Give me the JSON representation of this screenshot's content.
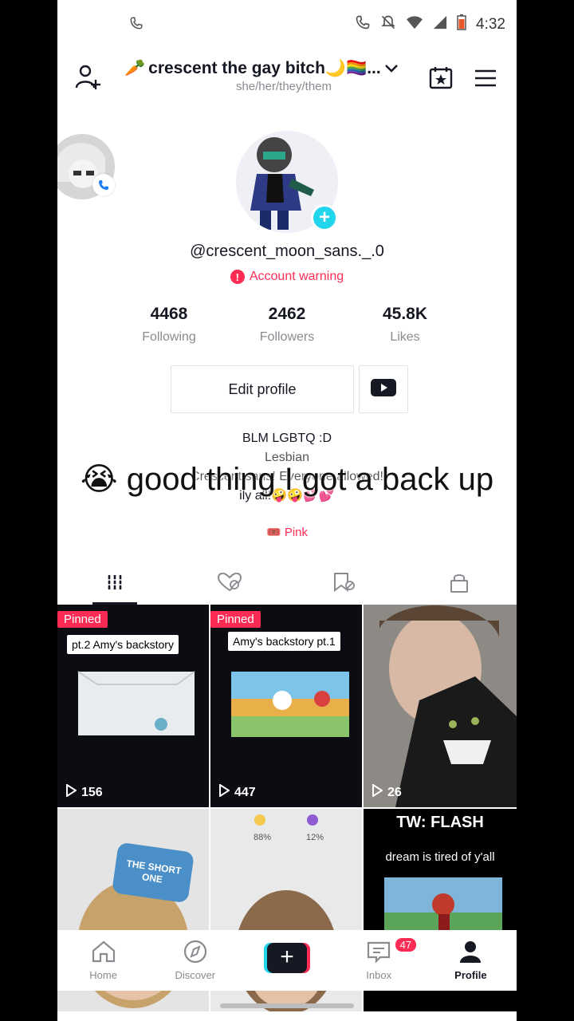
{
  "status_bar": {
    "time": "4:32"
  },
  "header": {
    "title": "crescent the gay bitch🌙🏳️‍🌈...",
    "subtitle": "she/her/they/them",
    "title_emoji": "🥕"
  },
  "profile": {
    "username": "@crescent_moon_sans._.0",
    "warning": "Account warning",
    "stats": [
      {
        "value": "4468",
        "label": "Following"
      },
      {
        "value": "2462",
        "label": "Followers"
      },
      {
        "value": "45.8K",
        "label": "Likes"
      }
    ],
    "edit_button": "Edit profile",
    "bio_lines": [
      "BLM LGBTQ :D",
      "Lesbian",
      "Crescent sans! Everyone allowed!",
      "ily all!🤪🤪💕💕"
    ],
    "link": "🎟️ Pink"
  },
  "overlay_caption": "😭 good thing I got a back up",
  "grid": {
    "pinned_label": "Pinned",
    "videos": [
      {
        "pinned": true,
        "title": "pt.2 Amy's backstory",
        "views": "156"
      },
      {
        "pinned": true,
        "title": "Amy's  backstory pt.1",
        "views": "447"
      },
      {
        "pinned": false,
        "title": "",
        "views": "26"
      },
      {
        "pinned": false,
        "title": "THE SHORT ONE",
        "views": ""
      },
      {
        "pinned": false,
        "title": "",
        "views": "",
        "pct_left": "88%",
        "pct_right": "12%"
      },
      {
        "pinned": false,
        "title": "TW: FLASH",
        "subtitle": "dream is tired of y'all",
        "views": ""
      }
    ]
  },
  "bottom_nav": {
    "items": [
      {
        "label": "Home"
      },
      {
        "label": "Discover"
      },
      {
        "label": ""
      },
      {
        "label": "Inbox",
        "badge": "47"
      },
      {
        "label": "Profile"
      }
    ]
  },
  "colors": {
    "accent": "#fe2c55",
    "cyan": "#20d5ec",
    "text": "#161823",
    "muted": "#8a8b91"
  }
}
